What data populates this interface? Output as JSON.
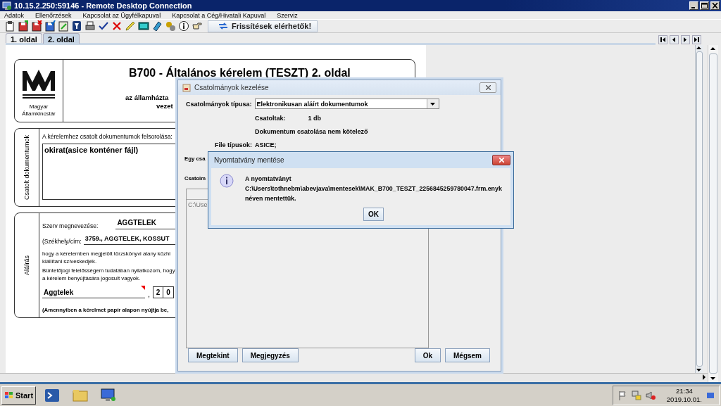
{
  "window": {
    "title": "10.15.2.250:59146 - Remote Desktop Connection"
  },
  "menu": [
    "Adatok",
    "Ellenőrzések",
    "Kapcsolat az Ügyfélkapuval",
    "Kapcsolat a Cég/Hivatali Kapuval",
    "Szerviz"
  ],
  "toolbar": {
    "update_button": "Frissítések elérhetők!"
  },
  "page_tabs": [
    {
      "label": "1. oldal",
      "selected": false
    },
    {
      "label": "2. oldal",
      "selected": true
    }
  ],
  "form": {
    "logo_text": [
      "Magyar",
      "Államkincstár"
    ],
    "title": "B700 - Általános kérelem (TESZT) 2. oldal",
    "subtitle_lines": [
      "az államházta",
      "vezet"
    ],
    "attachments_section": {
      "side_label": "Csatolt dokumentumok",
      "prompt": "A kérelemhez csatolt dokumentumok felsorolása:",
      "list_value": "okirat(asice konténer fájl)"
    },
    "signature_section": {
      "side_label": "Aláírás",
      "fields": [
        {
          "label": "Szerv megnevezése:",
          "value": "AGGTELEK"
        },
        {
          "label": "(Székhely/cím:",
          "value": "3759., AGGTELEK, KOSSUT"
        }
      ],
      "paragraph_lines": [
        "hogy a kérelemben megjelölt törzskönyvi alany közhi",
        "kiállítani szíveskedjék.",
        "Büntetőjogi felelősségem tudatában nyilatkozom, hogy",
        "a kérelem benyújtására jogosult vagyok."
      ],
      "place": {
        "value": "Aggtelek",
        "required": true
      },
      "separator": ",",
      "date_digits": [
        "2",
        "0"
      ],
      "note": "(Amennyiben a kérelmet papír alapon nyújtja be,"
    }
  },
  "attach_dialog": {
    "title": "Csatolmányok kezelése",
    "type_label": "Csatolmányok típusa:",
    "type_value": "Elektronikusan aláírt dokumentumok",
    "attached_label": "Csatoltak:",
    "attached_count": "1 db",
    "requirement": "Dokumentum csatolása nem kötelező",
    "file_types_label": "File típusok:",
    "file_types": "ASICE;",
    "single_label": "Egy csa",
    "list_label": "Csatolm",
    "list_items": [
      "C:\\Use"
    ],
    "buttons": [
      "Megtekint",
      "Megjegyzés",
      "Ok",
      "Mégsem"
    ]
  },
  "message_dialog": {
    "title": "Nyomtatvány mentése",
    "lines": [
      "A nyomtatványt",
      "C:\\Users\\tothnebm\\abevjava\\mentesek\\MAK_B700_TESZT_2256845259780047.frm.enyk",
      "néven mentettük."
    ],
    "button": "OK"
  },
  "taskbar": {
    "start": "Start",
    "time": "21:34",
    "date": "2019.10.01."
  }
}
